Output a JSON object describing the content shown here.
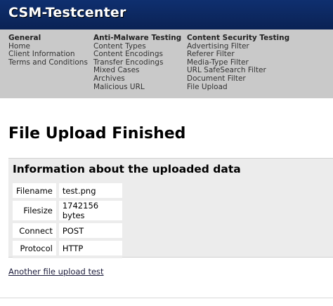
{
  "header": {
    "logo_text": "CSM-Testcenter"
  },
  "nav": {
    "general": {
      "heading": "General",
      "items": [
        "Home",
        "Client Information",
        "Terms and Conditions"
      ]
    },
    "anti_malware": {
      "heading": "Anti-Malware Testing",
      "items": [
        "Content Types",
        "Content Encodings",
        "Transfer Encodings",
        "Mixed Cases",
        "Archives",
        "Malicious URL"
      ]
    },
    "content_security": {
      "heading": "Content Security Testing",
      "items": [
        "Advertising Filter",
        "Referer Filter",
        "Media-Type Filter",
        "URL SafeSearch Filter",
        "Document Filter",
        "File Upload"
      ]
    }
  },
  "main": {
    "title": "File Upload Finished",
    "info_title": "Information about the uploaded data",
    "rows": [
      {
        "label": "Filename",
        "value": "test.png"
      },
      {
        "label": "Filesize",
        "value": "1742156 bytes"
      },
      {
        "label": "Connect",
        "value": "POST"
      },
      {
        "label": "Protocol",
        "value": "HTTP"
      }
    ],
    "footer_link": "Another file upload test"
  },
  "colors": {
    "header_bg": "#0f2f6f",
    "nav_bg": "#c9c9c9",
    "info_bg": "#ececec"
  }
}
